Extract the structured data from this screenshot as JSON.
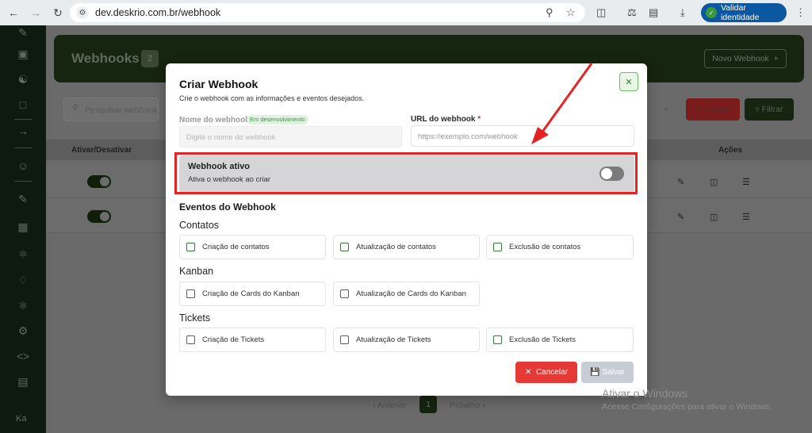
{
  "browser": {
    "url": "dev.deskrio.com.br/webhook",
    "verify_label": "Validar identidade"
  },
  "background_page": {
    "title": "Webhooks",
    "count": "2",
    "new_button": "Novo Webhook",
    "search_placeholder": "Pesquisar webhook",
    "clear_button": "Limpar",
    "filter_button": "Filtrar",
    "table_headers": {
      "toggle": "Ativar/Desativar",
      "actions": "Ações"
    },
    "pager": {
      "prev": "Anterior",
      "page": "1",
      "next": "Próximo"
    },
    "user_initials": "Ka"
  },
  "modal": {
    "title": "Criar Webhook",
    "subtitle": "Crie o webhook com as informações e eventos desejados.",
    "name_label": "Nome do webhook",
    "name_badge": "Em desenvolvimento",
    "name_placeholder": "Digite o nome do webhook",
    "url_label": "URL do webhook",
    "url_required_mark": "*",
    "url_placeholder": "https://exemplo.com/webhook",
    "active_title": "Webhook ativo",
    "active_subtitle": "Ativa o webhook ao criar",
    "active_enabled": false,
    "events_title": "Eventos do Webhook",
    "groups": [
      {
        "name": "Contatos",
        "events": [
          "Criação de contatos",
          "Atualização de contatos",
          "Exclusão de contatos"
        ]
      },
      {
        "name": "Kanban",
        "events": [
          "Criação de Cards do Kanban",
          "Atualização de Cards do Kanban"
        ]
      },
      {
        "name": "Tickets",
        "events": [
          "Criação de Tickets",
          "Atualização de Tickets",
          "Exclusão de Tickets"
        ]
      }
    ],
    "cancel_label": "Cancelar",
    "save_label": "Salvar",
    "close_icon": "close-icon"
  },
  "watermark": {
    "line1": "Ativar o Windows",
    "line2": "Acesse Configurações para ativar o Windows."
  },
  "colors": {
    "brand_green": "#16250f",
    "accent_red": "#e53935",
    "annotation_red": "#e52323"
  }
}
